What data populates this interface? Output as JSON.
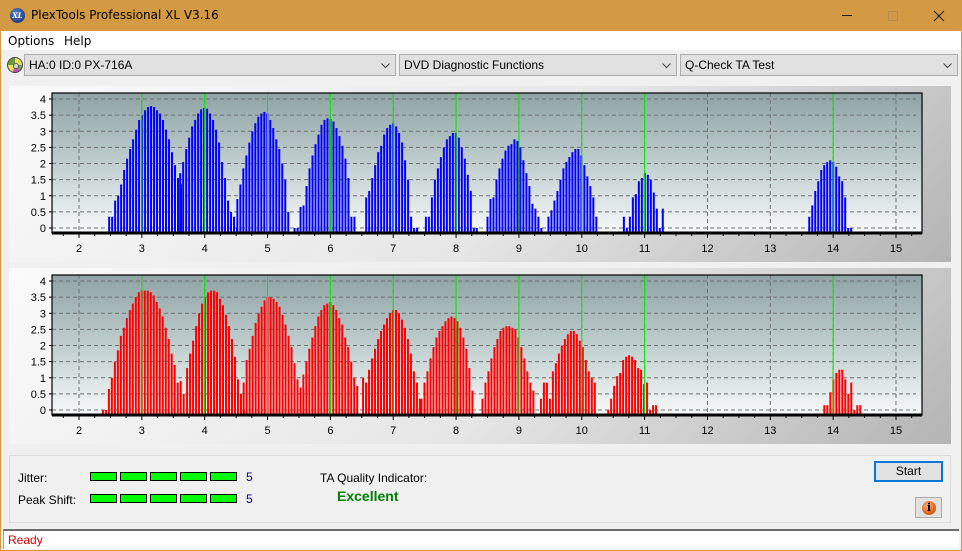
{
  "window": {
    "title": "PlexTools Professional XL V3.16",
    "app_icon": "xl-logo-icon",
    "app_icon_text": "XL",
    "controls": [
      "minimize-icon",
      "maximize-icon",
      "close-icon"
    ]
  },
  "menu": {
    "items": [
      {
        "label": "Options"
      },
      {
        "label": "Help"
      }
    ]
  },
  "toolbar": {
    "drive_icon": "disc-drive-icon",
    "drive_select": "HA:0 ID:0  PX-716A",
    "function_select": "DVD Diagnostic Functions",
    "test_select": "Q-Check TA Test"
  },
  "bottom": {
    "jitter_label": "Jitter:",
    "jitter_value": "5",
    "jitter_level": 5,
    "jitter_max": 5,
    "peak_shift_label": "Peak Shift:",
    "peak_shift_value": "5",
    "peak_shift_level": 5,
    "peak_shift_max": 5,
    "ta_quality_label": "TA Quality Indicator:",
    "ta_quality_value": "Excellent",
    "start_label": "Start",
    "info_icon": "info-icon",
    "info_text": "i"
  },
  "status": {
    "text": "Ready"
  },
  "colors": {
    "title_bar": "#d49a43",
    "top_bars": "#0000ff",
    "bottom_bars": "#ff0000",
    "reference_lines": "#00ff00",
    "meter_fill": "#00ff00",
    "quality_text": "#008000",
    "status_text": "#e00000"
  },
  "chart_data": [
    {
      "type": "bar",
      "name": "top-distribution",
      "color": "#0000ff",
      "xlim": [
        1.6,
        15.4
      ],
      "ylim": [
        -0.15,
        4.15
      ],
      "xticks": [
        "2",
        "3",
        "4",
        "5",
        "6",
        "7",
        "8",
        "9",
        "10",
        "11",
        "12",
        "13",
        "14",
        "15"
      ],
      "yticks": [
        "0",
        "0.5",
        "1",
        "1.5",
        "2",
        "2.5",
        "3",
        "3.5",
        "4"
      ],
      "reference_lines": [
        3,
        4,
        5,
        6,
        7,
        8,
        9,
        10,
        11,
        14
      ],
      "grid": true,
      "peaks": [
        {
          "x_start": 2.48,
          "values": [
            0.35,
            0.35,
            0.85,
            1.0,
            1.35,
            1.8,
            2.15,
            2.45,
            2.75,
            3.05,
            3.35,
            3.5,
            3.65,
            3.75,
            3.78,
            3.75,
            3.65,
            3.55,
            3.35,
            3.05,
            2.75,
            2.35,
            1.95,
            1.55,
            1.35
          ]
        },
        {
          "x_start": 3.61,
          "values": [
            1.7,
            2.05,
            2.45,
            2.8,
            3.15,
            3.35,
            3.55,
            3.68,
            3.72,
            3.7,
            3.55,
            3.35,
            3.05,
            2.65,
            2.05,
            1.55,
            0.85,
            0.5,
            0.35,
            0.0
          ]
        },
        {
          "x_start": 4.52,
          "values": [
            0.9,
            1.35,
            1.85,
            2.25,
            2.65,
            3.0,
            3.25,
            3.45,
            3.55,
            3.6,
            3.55,
            3.35,
            3.1,
            2.75,
            2.45,
            2.0,
            1.5,
            0.5
          ]
        },
        {
          "x_start": 5.43,
          "values": [
            0.0,
            0.0,
            0.65,
            0.7,
            1.3,
            1.85,
            2.25,
            2.6,
            2.9,
            3.2,
            3.35,
            3.4,
            3.38,
            3.3,
            3.1,
            2.85,
            2.55,
            2.15,
            1.55,
            0.35,
            0.35
          ]
        },
        {
          "x_start": 6.57,
          "values": [
            0.95,
            1.15,
            1.55,
            1.95,
            2.35,
            2.55,
            2.9,
            3.1,
            3.2,
            3.25,
            3.15,
            2.95,
            2.65,
            2.1,
            1.5,
            0.35,
            0.0,
            0.0
          ]
        },
        {
          "x_start": 7.52,
          "values": [
            0.35,
            0.35,
            0.95,
            1.5,
            1.85,
            2.2,
            2.5,
            2.75,
            2.85,
            2.95,
            2.95,
            2.8,
            2.5,
            2.15,
            1.65,
            1.15,
            0.0,
            0.0
          ]
        },
        {
          "x_start": 8.5,
          "values": [
            0.35,
            0.9,
            0.95,
            1.5,
            1.85,
            2.15,
            2.4,
            2.55,
            2.6,
            2.75,
            2.7,
            2.5,
            2.1,
            1.7,
            1.3,
            0.75,
            0.6,
            0.35,
            0.0
          ]
        },
        {
          "x_start": 9.47,
          "values": [
            0.35,
            0.55,
            0.85,
            1.15,
            1.5,
            1.85,
            2.05,
            2.2,
            2.35,
            2.45,
            2.45,
            2.25,
            1.95,
            1.6,
            1.3,
            0.95,
            0.35
          ]
        },
        {
          "x_start": 10.67,
          "values": [
            0.35,
            0.0,
            0.35,
            0.95,
            1.05,
            1.45,
            1.55,
            1.7,
            1.65,
            1.5,
            1.1,
            0.6,
            0.0,
            0.6
          ]
        },
        {
          "x_start": 13.62,
          "values": [
            0.35,
            0.7,
            1.15,
            1.45,
            1.8,
            1.95,
            2.05,
            2.1,
            2.05,
            1.9,
            1.6,
            1.45,
            0.95,
            0.0,
            0.0
          ]
        }
      ]
    },
    {
      "type": "bar",
      "name": "bottom-distribution",
      "color": "#ff0000",
      "xlim": [
        1.6,
        15.4
      ],
      "ylim": [
        -0.15,
        4.15
      ],
      "xticks": [
        "2",
        "3",
        "4",
        "5",
        "6",
        "7",
        "8",
        "9",
        "10",
        "11",
        "12",
        "13",
        "14",
        "15"
      ],
      "yticks": [
        "0",
        "0.5",
        "1",
        "1.5",
        "2",
        "2.5",
        "3",
        "3.5",
        "4"
      ],
      "reference_lines": [
        3,
        4,
        5,
        6,
        7,
        8,
        9,
        10,
        11,
        14
      ],
      "grid": true,
      "peaks": [
        {
          "x_start": 2.38,
          "values": [
            0.0,
            0.0,
            0.65,
            1.0,
            1.5,
            1.85,
            2.3,
            2.55,
            2.85,
            3.1,
            3.3,
            3.5,
            3.65,
            3.7,
            3.7,
            3.7,
            3.65,
            3.55,
            3.35,
            3.15,
            2.9,
            2.55,
            2.2,
            1.75,
            1.4,
            0.85,
            0.9,
            0.5
          ]
        },
        {
          "x_start": 3.72,
          "values": [
            1.3,
            1.75,
            2.15,
            2.6,
            3.0,
            3.3,
            3.5,
            3.65,
            3.7,
            3.7,
            3.65,
            3.45,
            3.25,
            2.95,
            2.6,
            2.2,
            1.65,
            0.95,
            0.5,
            0.0
          ]
        },
        {
          "x_start": 4.62,
          "values": [
            0.85,
            1.55,
            1.9,
            2.3,
            2.7,
            3.0,
            3.2,
            3.4,
            3.5,
            3.5,
            3.45,
            3.35,
            3.2,
            2.95,
            2.65,
            2.3,
            1.95,
            1.45,
            0.95,
            0.7,
            0.65
          ]
        },
        {
          "x_start": 5.57,
          "values": [
            1.1,
            1.5,
            1.9,
            2.25,
            2.6,
            2.9,
            3.1,
            3.25,
            3.3,
            3.35,
            3.25,
            3.1,
            2.85,
            2.65,
            2.25,
            1.95,
            1.5,
            1.0,
            0.75
          ]
        },
        {
          "x_start": 6.52,
          "values": [
            1.0,
            0.85,
            1.25,
            1.6,
            1.9,
            2.2,
            2.45,
            2.65,
            2.85,
            3.0,
            3.1,
            3.1,
            3.0,
            2.8,
            2.55,
            2.2,
            1.75,
            1.2,
            0.85,
            0.35
          ]
        },
        {
          "x_start": 7.45,
          "values": [
            0.35,
            0.85,
            1.2,
            1.6,
            1.95,
            2.25,
            2.45,
            2.6,
            2.75,
            2.85,
            2.9,
            2.85,
            2.75,
            2.55,
            2.25,
            1.9,
            1.3,
            0.6
          ]
        },
        {
          "x_start": 8.42,
          "values": [
            0.35,
            0.85,
            1.2,
            1.6,
            1.95,
            2.2,
            2.45,
            2.55,
            2.6,
            2.6,
            2.55,
            2.5,
            2.25,
            1.95,
            1.6,
            1.2,
            0.85,
            0.6
          ]
        },
        {
          "x_start": 9.35,
          "values": [
            0.35,
            0.85,
            0.85,
            0.35,
            1.2,
            1.45,
            1.75,
            2.0,
            2.2,
            2.35,
            2.45,
            2.45,
            2.35,
            2.15,
            1.95,
            1.55,
            1.2,
            1.0,
            0.85
          ]
        },
        {
          "x_start": 10.42,
          "values": [
            0.0,
            0.35,
            0.75,
            1.05,
            1.15,
            1.55,
            1.65,
            1.7,
            1.65,
            1.55,
            1.3,
            1.25,
            0.8,
            0.85,
            0.0,
            0.15,
            0.15
          ]
        },
        {
          "x_start": 13.86,
          "values": [
            0.15,
            0.15,
            0.55,
            0.95,
            1.15,
            1.25,
            1.25,
            0.95,
            0.5,
            0.85,
            0.0,
            0.15,
            0.15
          ]
        }
      ]
    }
  ]
}
